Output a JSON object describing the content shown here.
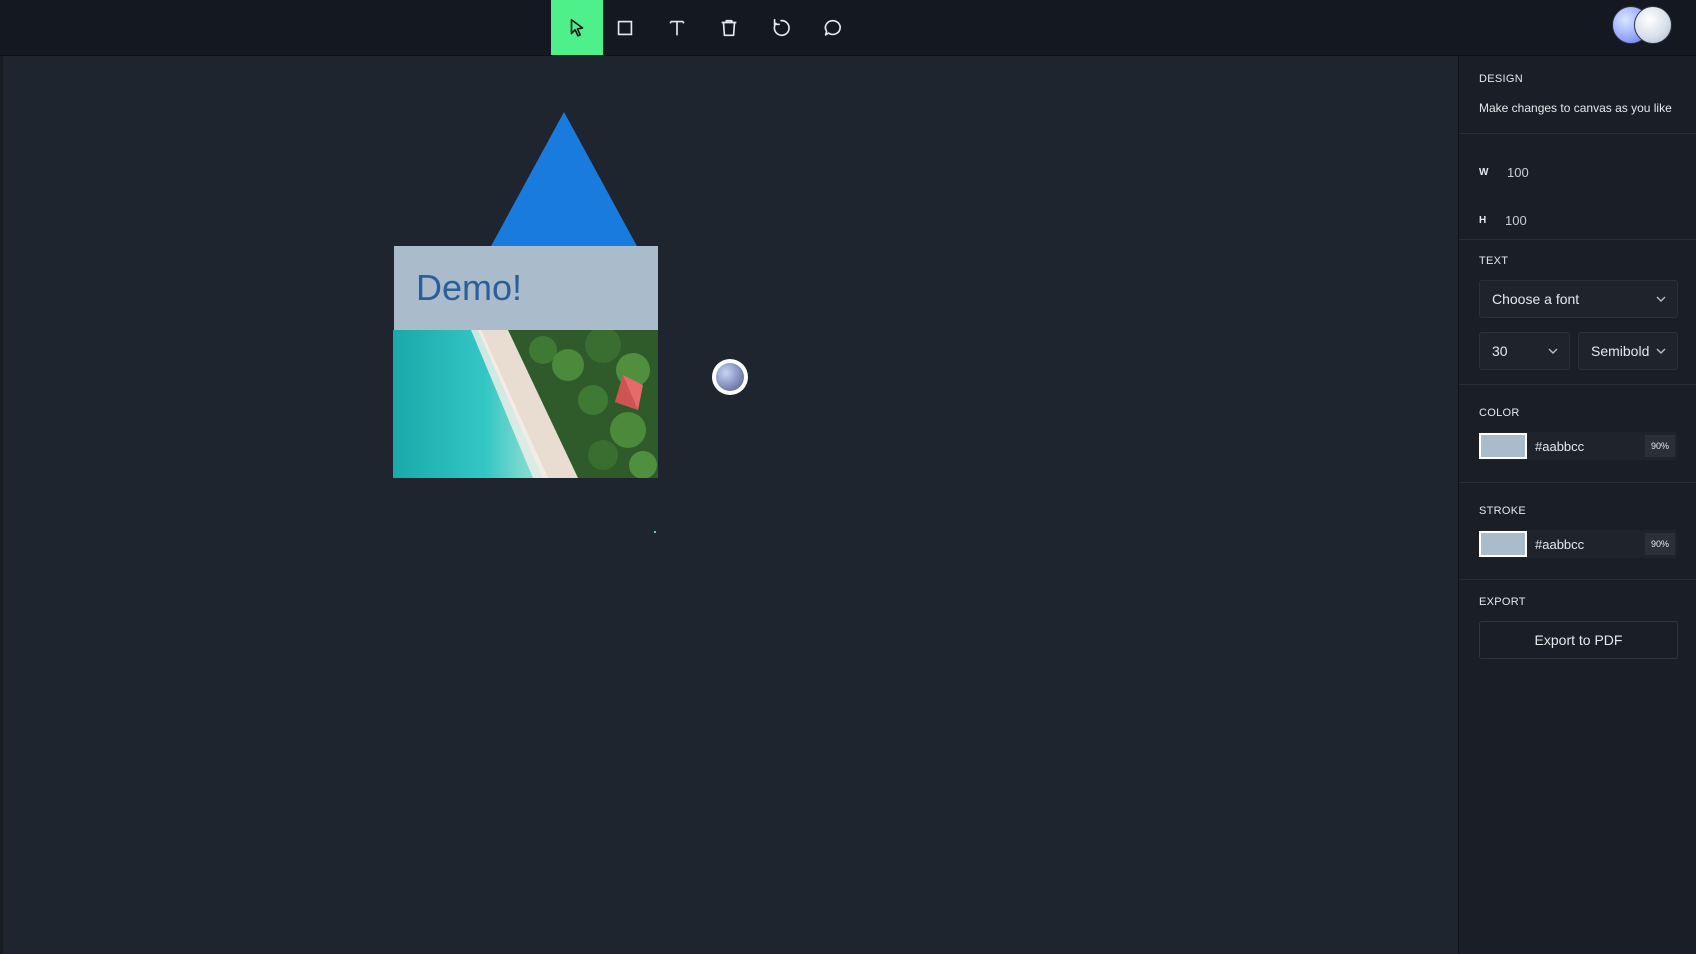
{
  "toolbar": {
    "tools": [
      {
        "name": "select-tool",
        "icon": "pointer-icon",
        "active": true
      },
      {
        "name": "rectangle-tool",
        "icon": "square-icon",
        "active": false
      },
      {
        "name": "text-tool",
        "icon": "text-icon",
        "active": false
      },
      {
        "name": "delete-tool",
        "icon": "trash-icon",
        "active": false
      },
      {
        "name": "undo-tool",
        "icon": "rotate-icon",
        "active": false
      },
      {
        "name": "comment-tool",
        "icon": "chat-icon",
        "active": false
      }
    ],
    "active_color": "#4ef08c"
  },
  "canvas": {
    "demo_text": "Demo!",
    "shape_fill": "#aabbcc",
    "triangle_color": "#1a7bde"
  },
  "panel": {
    "design": {
      "title": "DESIGN",
      "subtitle": "Make changes to canvas as you like"
    },
    "size": {
      "w_label": "W",
      "w_value": "100",
      "h_label": "H",
      "h_value": "100"
    },
    "text": {
      "title": "TEXT",
      "font_select": "Choose a font",
      "size_select": "30",
      "weight_select": "Semibold"
    },
    "color": {
      "title": "COLOR",
      "hex": "#aabbcc",
      "opacity": "90%"
    },
    "stroke": {
      "title": "STROKE",
      "hex": "#aabbcc",
      "opacity": "90%"
    },
    "export": {
      "title": "EXPORT",
      "button_label": "Export to PDF"
    }
  }
}
